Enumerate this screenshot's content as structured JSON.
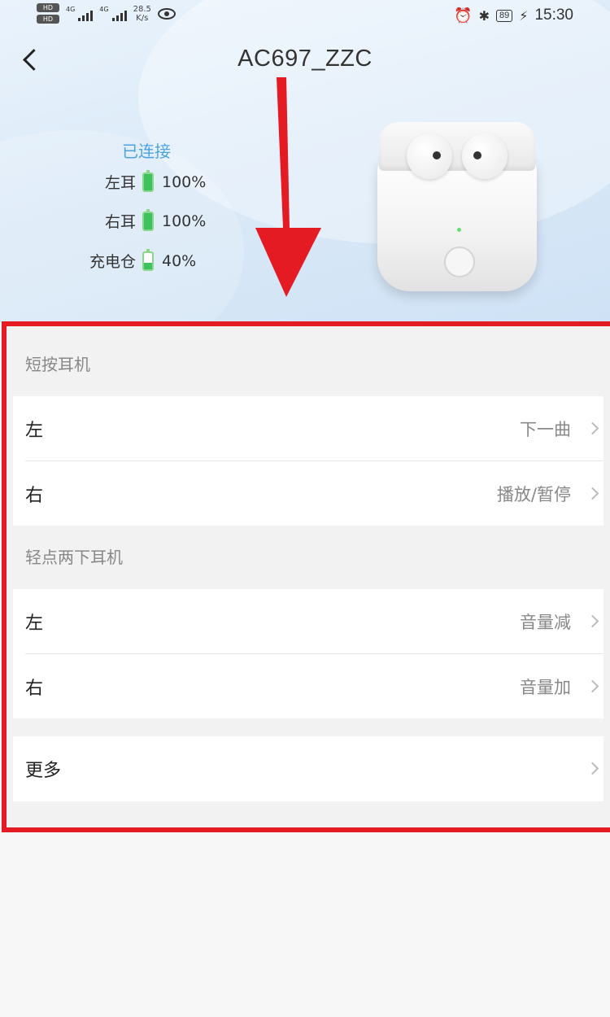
{
  "status_bar": {
    "hd_badge": "HD",
    "network_1": "4G",
    "network_2": "4G",
    "speed_value": "28.5",
    "speed_unit": "K/s",
    "battery_level": "89",
    "time": "15:30"
  },
  "header": {
    "title": "AC697_ZZC"
  },
  "device": {
    "status": "已连接",
    "batteries": [
      {
        "label": "左耳",
        "value": "100%",
        "level": 1.0
      },
      {
        "label": "右耳",
        "value": "100%",
        "level": 1.0
      },
      {
        "label": "充电仓",
        "value": "40%",
        "level": 0.4
      }
    ]
  },
  "settings": {
    "short_press": {
      "header": "短按耳机",
      "left": {
        "label": "左",
        "value": "下一曲"
      },
      "right": {
        "label": "右",
        "value": "播放/暂停"
      }
    },
    "double_tap": {
      "header": "轻点两下耳机",
      "left": {
        "label": "左",
        "value": "音量减"
      },
      "right": {
        "label": "右",
        "value": "音量加"
      }
    },
    "more": {
      "label": "更多"
    }
  },
  "colors": {
    "annotation_red": "#e41b23",
    "connected_blue": "#4aa3e3",
    "battery_green": "#3cc35c"
  }
}
